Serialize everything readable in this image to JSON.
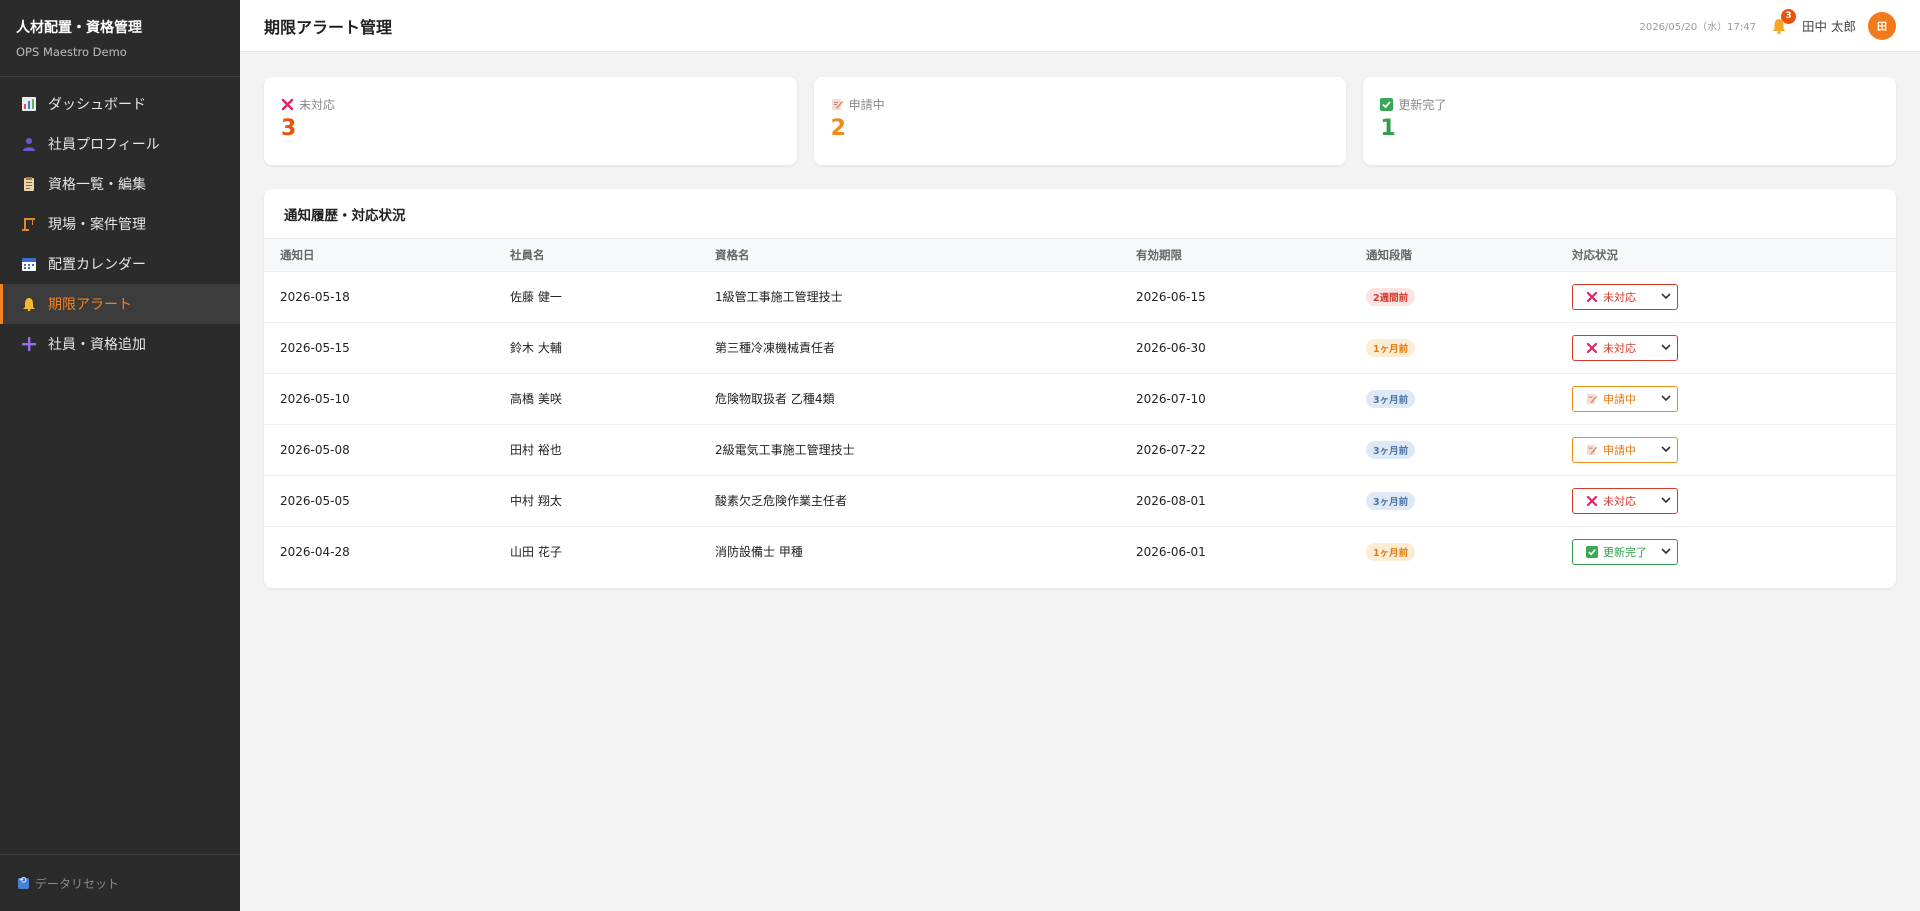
{
  "sidebar": {
    "brand_title": "人材配置・資格管理",
    "brand_sub": "OPS Maestro Demo",
    "items": [
      {
        "label": "ダッシュボード",
        "icon": "chart-icon"
      },
      {
        "label": "社員プロフィール",
        "icon": "person-icon"
      },
      {
        "label": "資格一覧・編集",
        "icon": "clipboard-icon"
      },
      {
        "label": "現場・案件管理",
        "icon": "crane-icon"
      },
      {
        "label": "配置カレンダー",
        "icon": "calendar-icon"
      },
      {
        "label": "期限アラート",
        "icon": "bell-icon",
        "active": true
      },
      {
        "label": "社員・資格追加",
        "icon": "plus-icon"
      }
    ],
    "footer_label": "データリセット"
  },
  "header": {
    "title": "期限アラート管理",
    "datetime": "2026/05/20（水）17:47",
    "notification_count": "3",
    "user_name": "田中 太郎",
    "avatar_initial": "田"
  },
  "summary": [
    {
      "label": "未対応",
      "value": "3",
      "icon": "x-icon",
      "color": "#e8530e"
    },
    {
      "label": "申請中",
      "value": "2",
      "icon": "memo-icon",
      "color": "#f08c1a"
    },
    {
      "label": "更新完了",
      "value": "1",
      "icon": "check-icon",
      "color": "#2e9e4b"
    }
  ],
  "table": {
    "title": "通知履歴・対応状況",
    "columns": [
      "通知日",
      "社員名",
      "資格名",
      "有効期限",
      "通知段階",
      "対応状況"
    ],
    "rows": [
      {
        "date": "2026-05-18",
        "name": "佐藤 健一",
        "qualification": "1級管工事施工管理技士",
        "expiry": "2026-06-15",
        "stage": "2週間前",
        "stage_color": "red",
        "status": "未対応",
        "status_type": "red"
      },
      {
        "date": "2026-05-15",
        "name": "鈴木 大輔",
        "qualification": "第三種冷凍機械責任者",
        "expiry": "2026-06-30",
        "stage": "1ヶ月前",
        "stage_color": "orange",
        "status": "未対応",
        "status_type": "red"
      },
      {
        "date": "2026-05-10",
        "name": "高橋 美咲",
        "qualification": "危険物取扱者 乙種4類",
        "expiry": "2026-07-10",
        "stage": "3ヶ月前",
        "stage_color": "blue",
        "status": "申請中",
        "status_type": "orange"
      },
      {
        "date": "2026-05-08",
        "name": "田村 裕也",
        "qualification": "2級電気工事施工管理技士",
        "expiry": "2026-07-22",
        "stage": "3ヶ月前",
        "stage_color": "blue",
        "status": "申請中",
        "status_type": "orange"
      },
      {
        "date": "2026-05-05",
        "name": "中村 翔太",
        "qualification": "酸素欠乏危険作業主任者",
        "expiry": "2026-08-01",
        "stage": "3ヶ月前",
        "stage_color": "blue",
        "status": "未対応",
        "status_type": "red"
      },
      {
        "date": "2026-04-28",
        "name": "山田 花子",
        "qualification": "消防設備士 甲種",
        "expiry": "2026-06-01",
        "stage": "1ヶ月前",
        "stage_color": "orange",
        "status": "更新完了",
        "status_type": "green"
      }
    ]
  }
}
